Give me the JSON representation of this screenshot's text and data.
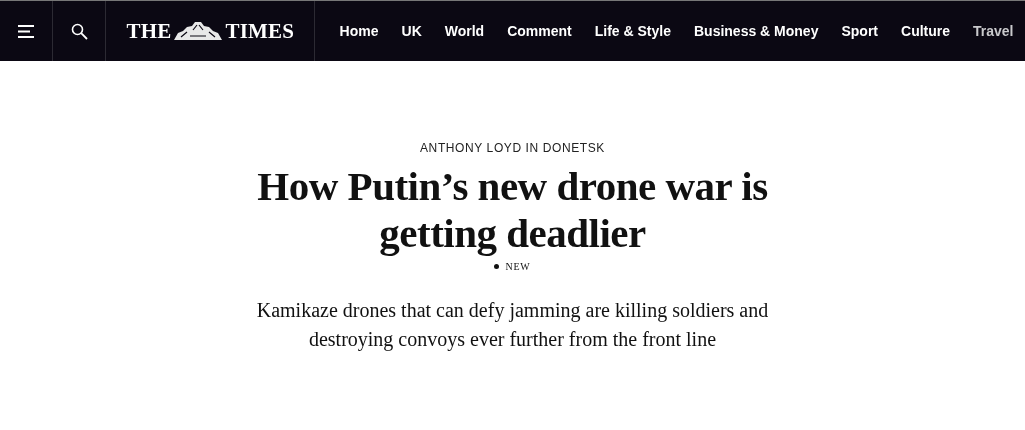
{
  "header": {
    "logo": {
      "left": "THE",
      "right": "TIMES"
    },
    "nav": [
      {
        "label": "Home"
      },
      {
        "label": "UK"
      },
      {
        "label": "World"
      },
      {
        "label": "Comment"
      },
      {
        "label": "Life & Style"
      },
      {
        "label": "Business & Money"
      },
      {
        "label": "Sport"
      },
      {
        "label": "Culture"
      },
      {
        "label": "Travel"
      }
    ]
  },
  "article": {
    "byline": "ANTHONY LOYD IN DONETSK",
    "headline": "How Putin’s new drone war is getting deadlier",
    "tag": "NEW",
    "standfirst": "Kamikaze drones that can defy jamming are killing soldiers and destroying convoys ever further from the front line"
  }
}
